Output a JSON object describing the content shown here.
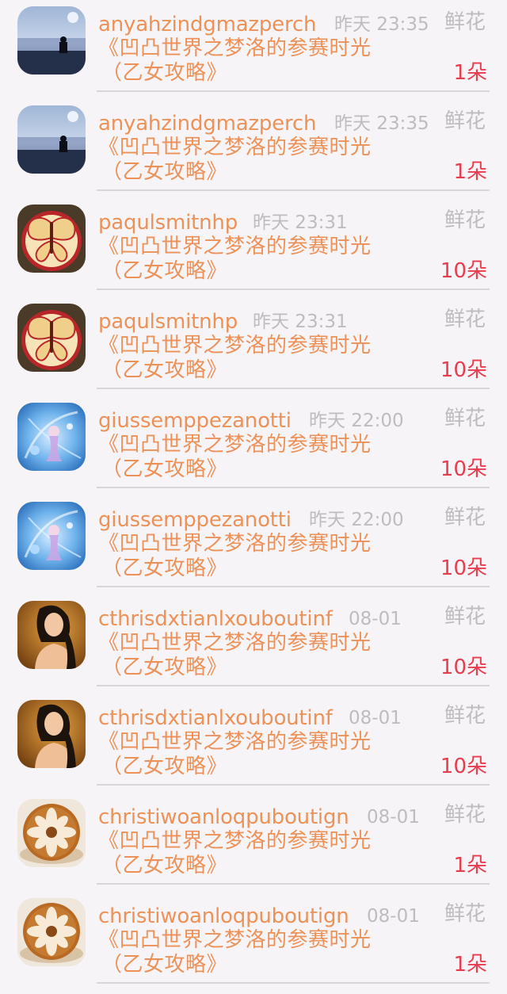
{
  "rows": [
    {
      "name": "anyahzindgmazperch",
      "time": "昨天 23:35",
      "gift": "鲜花",
      "title": "《凹凸世界之梦洛的参赛时光",
      "title2": "（乙女攻略》",
      "count": "1朵",
      "avatar": "avatar-sea-icon"
    },
    {
      "name": "anyahzindgmazperch",
      "time": "昨天 23:35",
      "gift": "鲜花",
      "title": "《凹凸世界之梦洛的参赛时光",
      "title2": "（乙女攻略》",
      "count": "1朵",
      "avatar": "avatar-sea-icon"
    },
    {
      "name": "paqulsmitnhp",
      "time": "昨天 23:31",
      "gift": "鲜花",
      "title": "《凹凸世界之梦洛的参赛时光",
      "title2": "（乙女攻略》",
      "count": "10朵",
      "avatar": "avatar-apple-butterfly-icon"
    },
    {
      "name": "paqulsmitnhp",
      "time": "昨天 23:31",
      "gift": "鲜花",
      "title": "《凹凸世界之梦洛的参赛时光",
      "title2": "（乙女攻略》",
      "count": "10朵",
      "avatar": "avatar-apple-butterfly-icon"
    },
    {
      "name": "giussemppezanotti",
      "time": "昨天 22:00",
      "gift": "鲜花",
      "title": "《凹凸世界之梦洛的参赛时光",
      "title2": "（乙女攻略》",
      "count": "10朵",
      "avatar": "avatar-blue-fantasy-icon"
    },
    {
      "name": "giussemppezanotti",
      "time": "昨天 22:00",
      "gift": "鲜花",
      "title": "《凹凸世界之梦洛的参赛时光",
      "title2": "（乙女攻略》",
      "count": "10朵",
      "avatar": "avatar-blue-fantasy-icon"
    },
    {
      "name": "cthrisdxtianlxouboutinf",
      "time": "08-01",
      "gift": "鲜花",
      "title": "《凹凸世界之梦洛的参赛时光",
      "title2": "（乙女攻略》",
      "count": "10朵",
      "avatar": "avatar-woman-portrait-icon"
    },
    {
      "name": "cthrisdxtianlxouboutinf",
      "time": "08-01",
      "gift": "鲜花",
      "title": "《凹凸世界之梦洛的参赛时光",
      "title2": "（乙女攻略》",
      "count": "10朵",
      "avatar": "avatar-woman-portrait-icon"
    },
    {
      "name": "christiwoanloqpuboutign",
      "time": "08-01",
      "gift": "鲜花",
      "title": "《凹凸世界之梦洛的参赛时光",
      "title2": "（乙女攻略》",
      "count": "1朵",
      "avatar": "avatar-latte-art-icon"
    },
    {
      "name": "christiwoanloqpuboutign",
      "time": "08-01",
      "gift": "鲜花",
      "title": "《凹凸世界之梦洛的参赛时光",
      "title2": "（乙女攻略》",
      "count": "1朵",
      "avatar": "avatar-latte-art-icon"
    }
  ],
  "colors": {
    "name": "#ec9259",
    "muted": "#bdbcbf",
    "count": "#e83c4f",
    "background": "#f7f4f7"
  }
}
